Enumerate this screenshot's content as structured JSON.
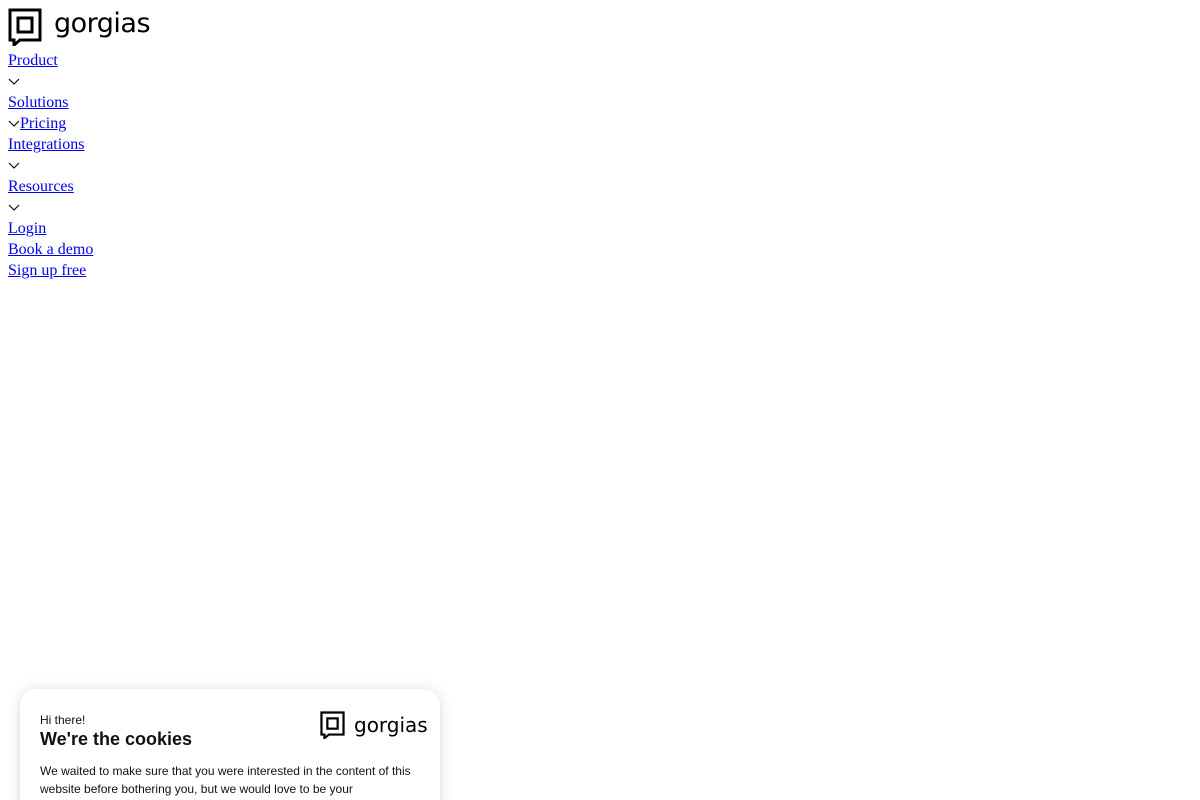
{
  "brand": {
    "name": "gorgias",
    "logo_icon": "gorgias-logo-icon"
  },
  "nav": {
    "items": [
      {
        "label": "Product",
        "has_dropdown": true
      },
      {
        "label": "Solutions",
        "has_dropdown": true
      },
      {
        "label": "Pricing",
        "has_dropdown": false
      },
      {
        "label": "Integrations",
        "has_dropdown": true
      },
      {
        "label": "Resources",
        "has_dropdown": true
      }
    ],
    "login": "Login",
    "book_demo": "Book a demo",
    "signup": "Sign up free"
  },
  "cookie_banner": {
    "greeting": "Hi there!",
    "title": "We're the cookies",
    "body": "We waited to make sure that you were interested in the content of this website before bothering you, but we would love to be your",
    "logo_text": "gorgias"
  },
  "colors": {
    "link": "#0000ee",
    "text": "#000000",
    "background": "#ffffff"
  }
}
